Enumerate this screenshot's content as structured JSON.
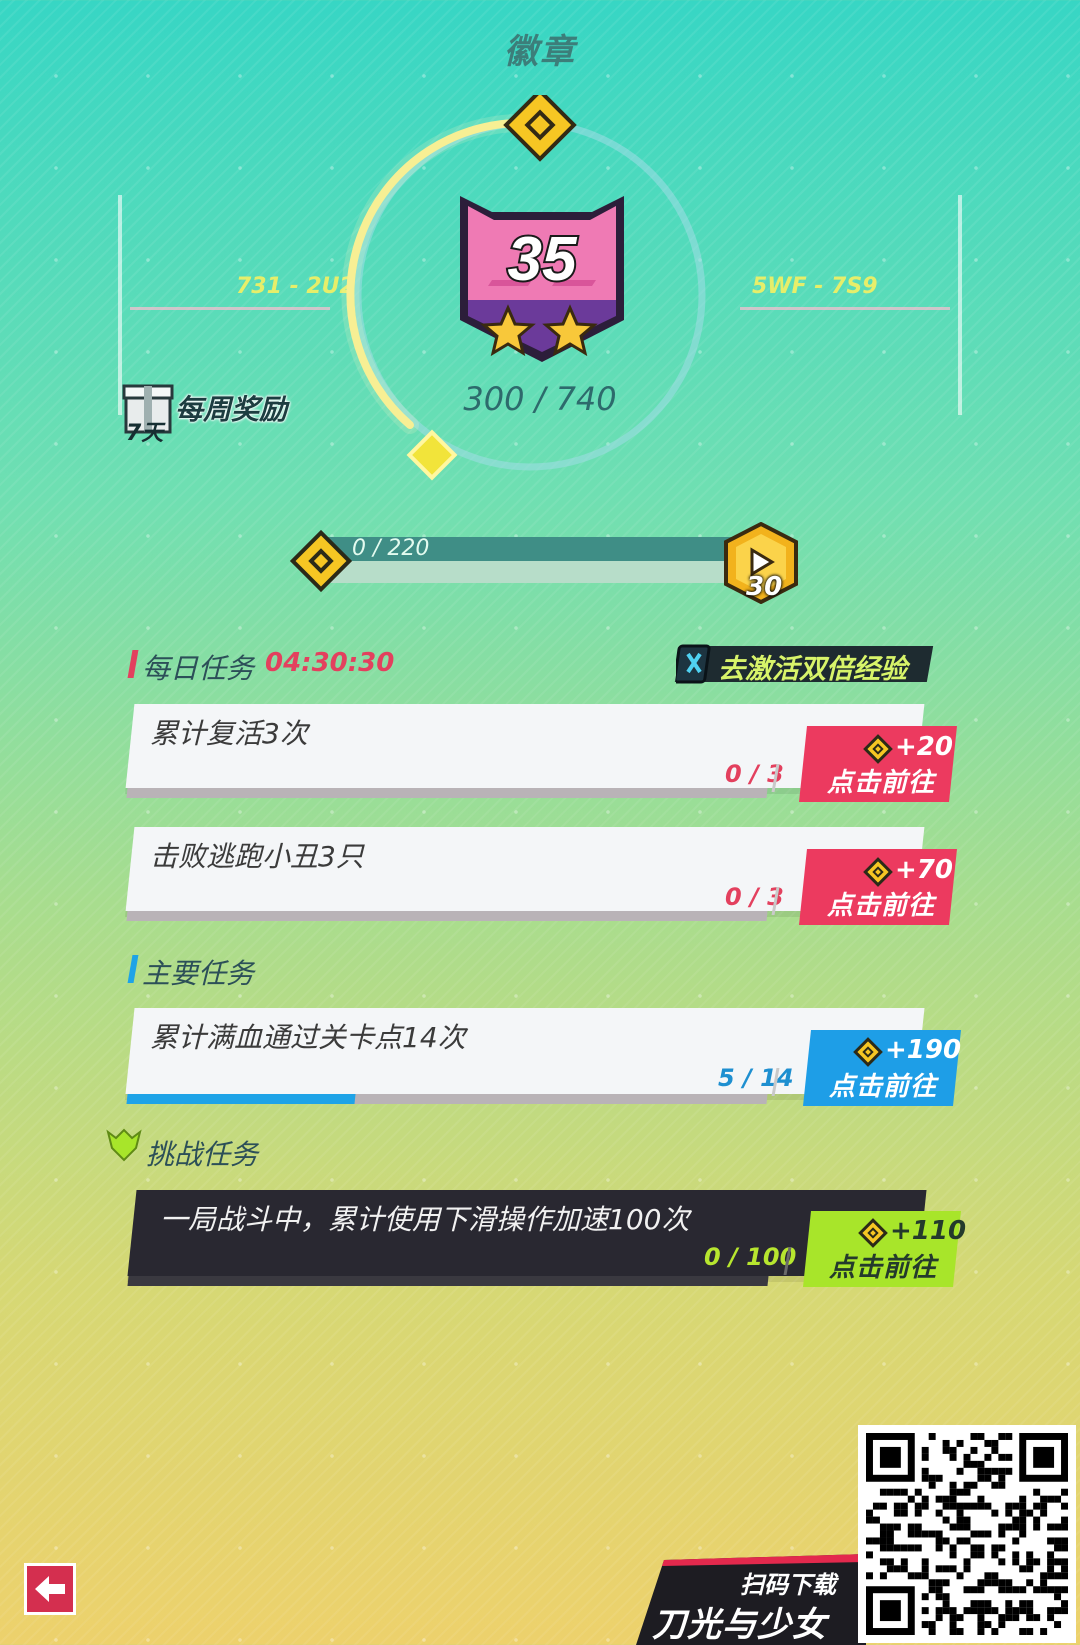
{
  "page": {
    "title": "徽章"
  },
  "ring": {
    "left_code": "731 - 2U2",
    "right_code": "5WF - 7S9"
  },
  "badge": {
    "level": "35",
    "stars": 2,
    "score": "300 / 740"
  },
  "weekly_reward": {
    "label": "每周奖励",
    "days": "7天"
  },
  "xp_bar": {
    "text": "0 / 220",
    "progress": 0.0,
    "target_level": "30"
  },
  "daily": {
    "title": "每日任务",
    "timer": "04:30:30",
    "double_exp_label": "去激活双倍经验",
    "tasks": [
      {
        "text": "累计复活3次",
        "progress": "0 / 3",
        "fraction": 0.0,
        "reward": "+20",
        "action": "点击前往"
      },
      {
        "text": "击败逃跑小丑3只",
        "progress": "0 / 3",
        "fraction": 0.0,
        "reward": "+70",
        "action": "点击前往"
      }
    ]
  },
  "main": {
    "title": "主要任务",
    "tasks": [
      {
        "text": "累计满血通过关卡点14次",
        "progress": "5 / 14",
        "fraction": 0.357,
        "reward": "+190",
        "action": "点击前往"
      }
    ]
  },
  "challenge": {
    "title": "挑战任务",
    "tasks": [
      {
        "text": "一局战斗中，累计使用下滑操作加速100次",
        "progress": "0 / 100",
        "fraction": 0.0,
        "reward": "+110",
        "action": "点击前往"
      }
    ]
  },
  "download": {
    "line1": "扫码下载",
    "line2": "刀光与少女"
  },
  "colors": {
    "daily_button": "#ec3a5f",
    "main_button": "#1e9ee7",
    "challenge_button": "#a8e52a",
    "accent_red": "#e3405e",
    "accent_blue": "#1ea3e7"
  },
  "icons": {
    "token": "diamond-token-icon",
    "back": "back-arrow-icon",
    "weekly": "gift-box-icon",
    "double": "book-icon",
    "challenge": "challenge-crest-icon"
  }
}
